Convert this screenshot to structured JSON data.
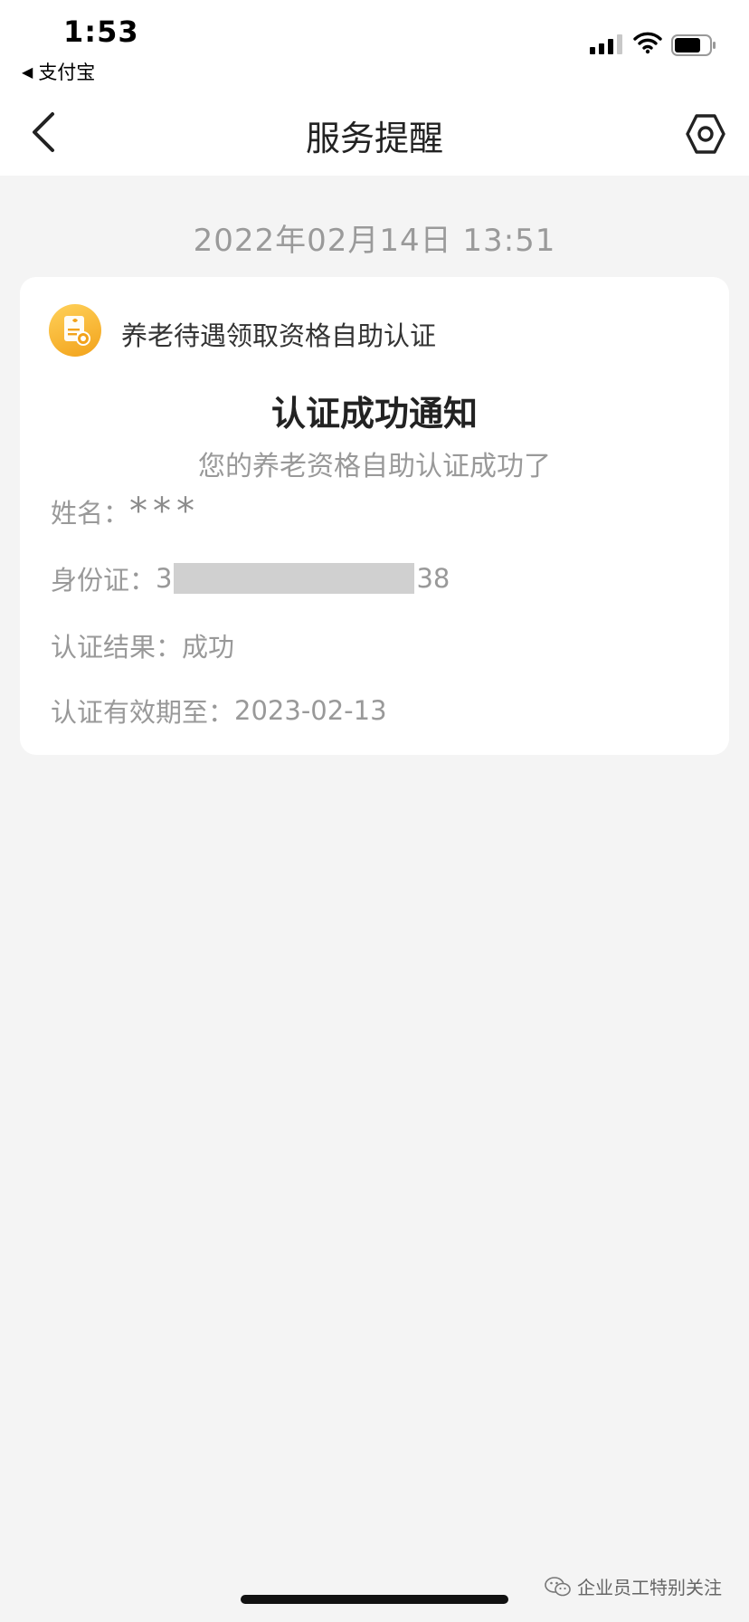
{
  "status_bar": {
    "time": "1:53",
    "back_app": "支付宝",
    "back_triangle": "◀"
  },
  "nav": {
    "title": "服务提醒"
  },
  "message": {
    "date": "2022年02月14日   13:51",
    "service_name": "养老待遇领取资格自助认证",
    "title": "认证成功通知",
    "subtitle": "您的养老资格自助认证成功了",
    "fields": {
      "name_label": "姓名：",
      "name_value": "***",
      "id_label": "身份证：",
      "id_prefix": "3",
      "id_suffix": "38",
      "result_label": "认证结果：",
      "result_value": "成功",
      "valid_label": "认证有效期至：",
      "valid_value": "2023-02-13"
    }
  },
  "watermark": {
    "text": "企业员工特别关注"
  },
  "icons": {
    "back": "chevron-left-icon",
    "settings": "hexagon-settings-icon",
    "app": "certificate-icon",
    "wechat": "wechat-icon"
  },
  "colors": {
    "accent": "#f2a21a",
    "background": "#f4f4f4"
  }
}
